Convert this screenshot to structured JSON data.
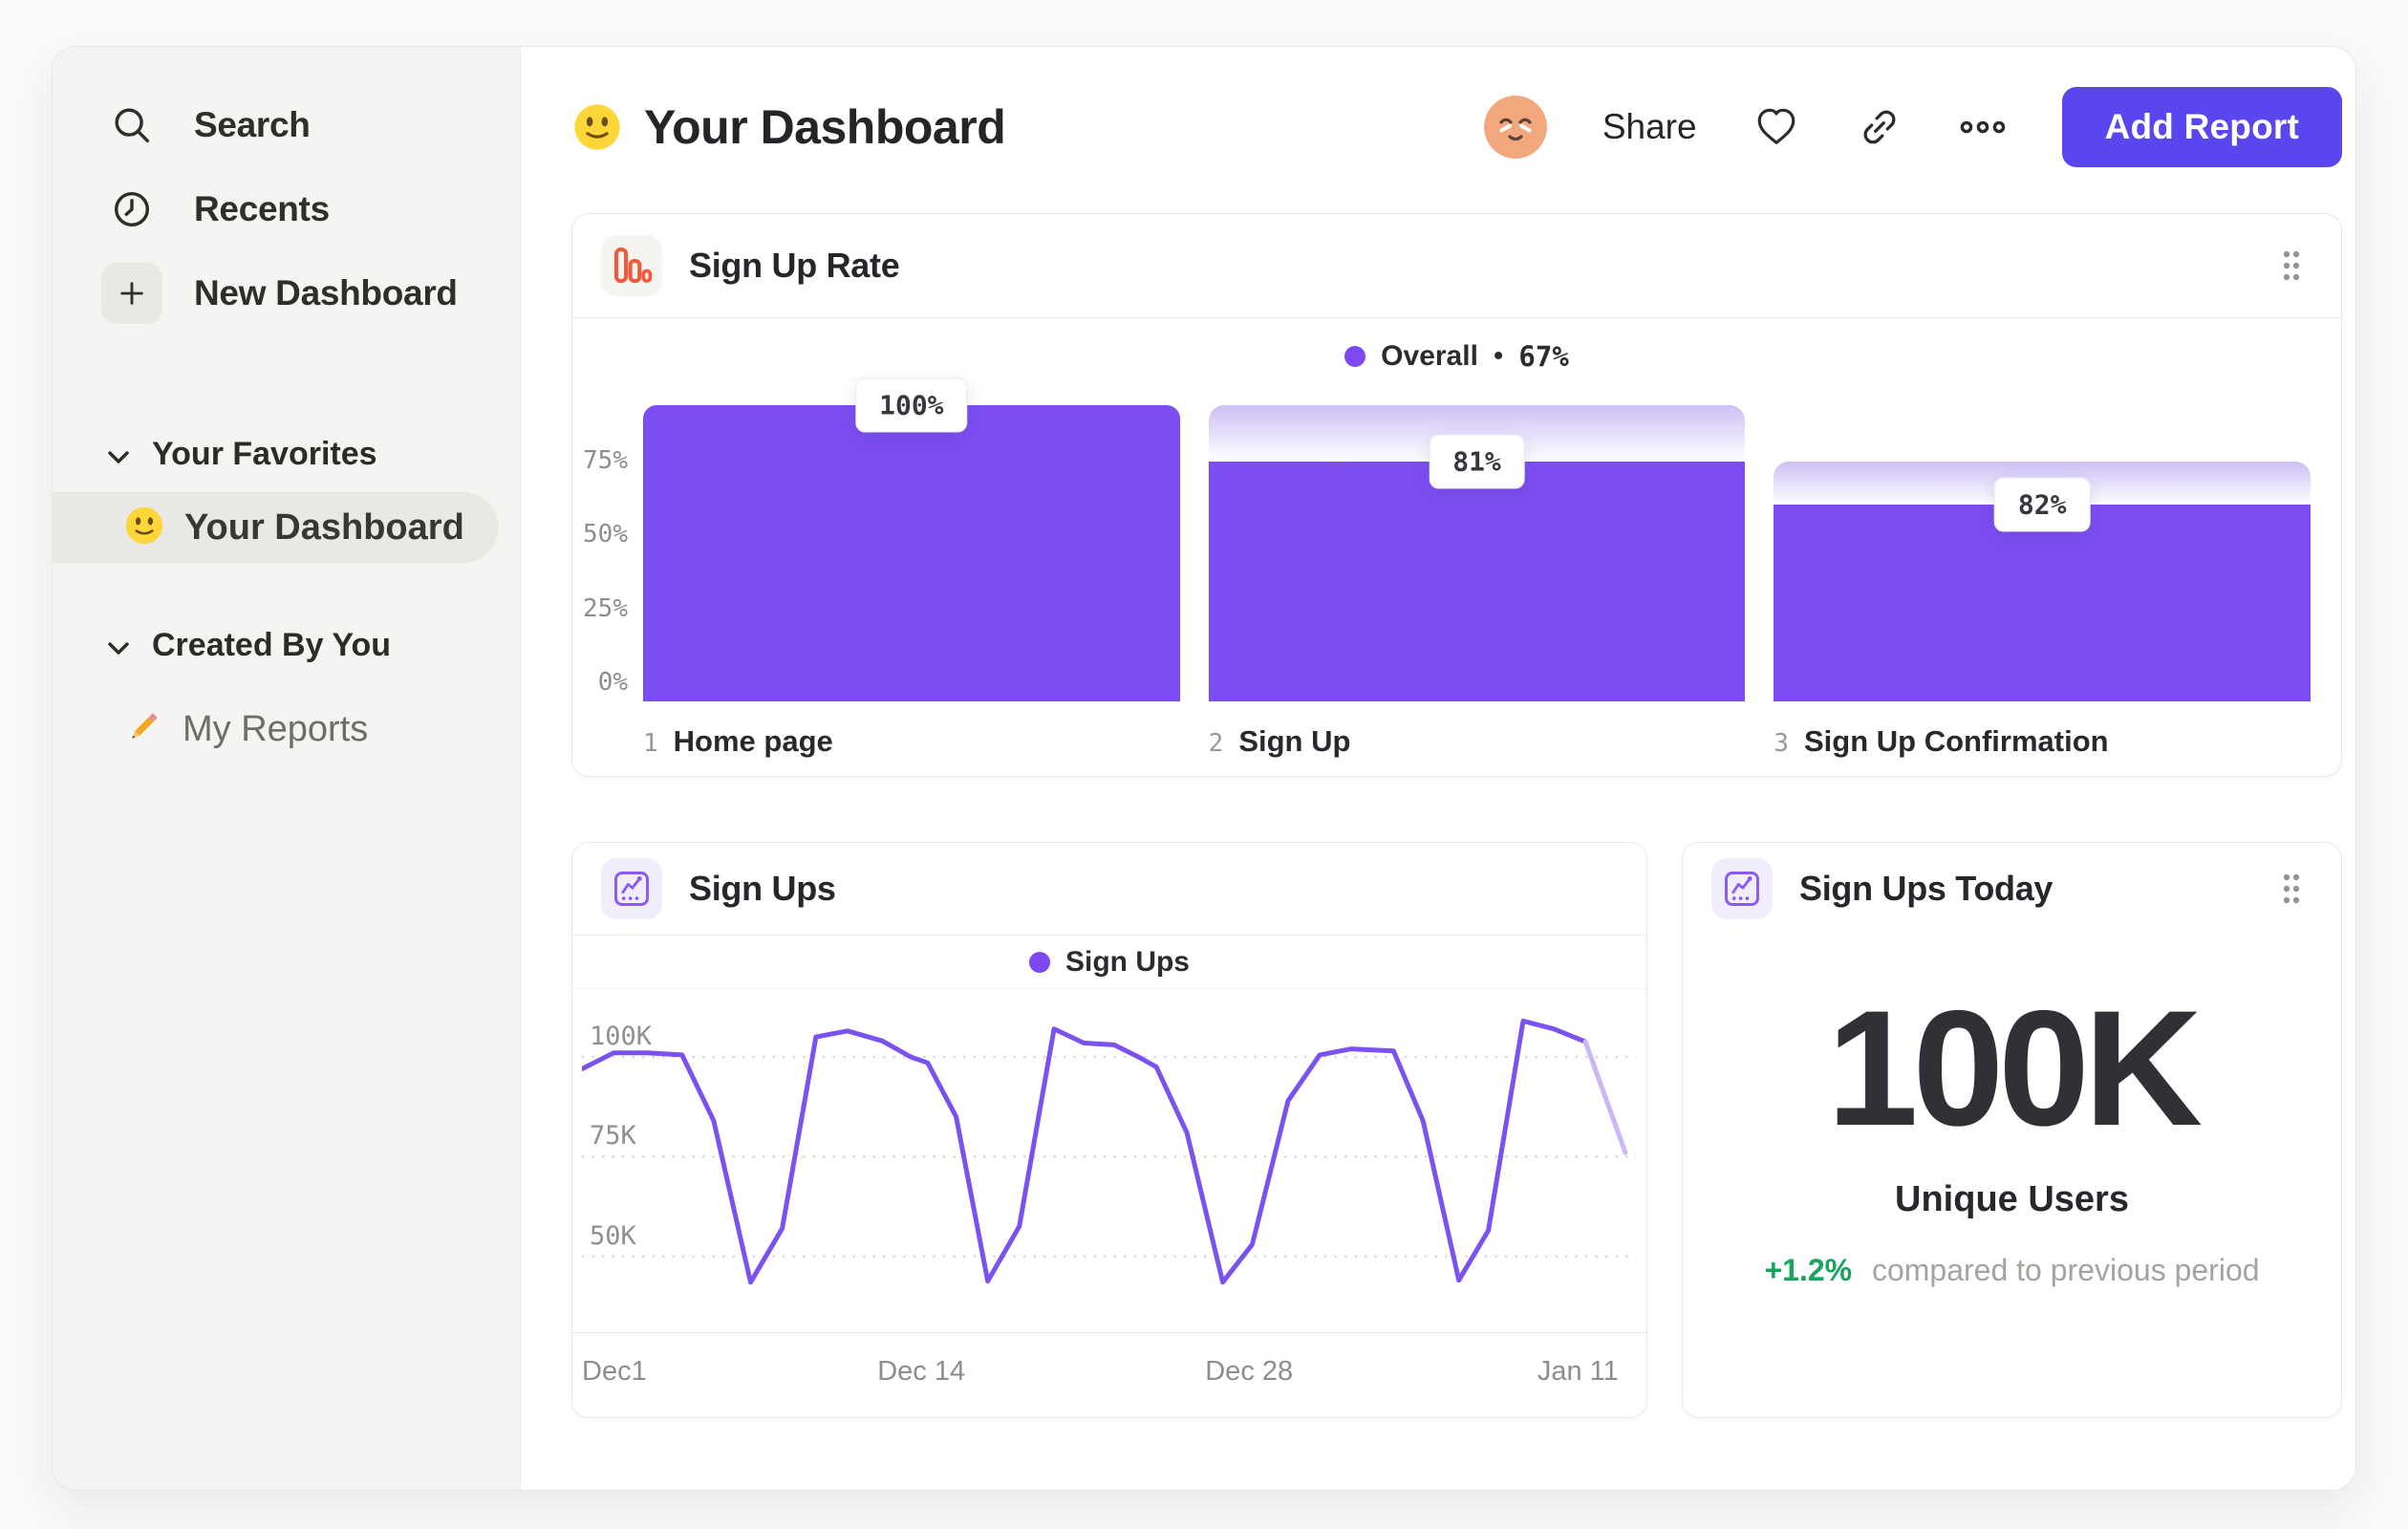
{
  "colors": {
    "accent_purple": "#7c4ef2",
    "button_purple": "#5a46ee",
    "line_purple": "#7b51f0",
    "funnel_fade_top": "#cdbff6",
    "icon_orange": "#f2593a",
    "icon_violet": "#8a5bf4",
    "positive_green": "#17a45c",
    "sidebar_bg": "#f5f4f2"
  },
  "sidebar": {
    "nav": [
      {
        "icon": "search-icon",
        "label": "Search"
      },
      {
        "icon": "clock-icon",
        "label": "Recents"
      },
      {
        "icon": "plus-icon",
        "label": "New Dashboard"
      }
    ],
    "sections": [
      {
        "label": "Your Favorites",
        "items": [
          {
            "emoji_char": "🙂",
            "emoji_name": "slightly-smiling-face",
            "label": "Your Dashboard",
            "selected": true
          }
        ]
      },
      {
        "label": "Created By You",
        "items": [
          {
            "emoji_char": "✏️",
            "emoji_name": "pencil",
            "label": "My Reports",
            "selected": false
          }
        ]
      }
    ]
  },
  "header": {
    "emoji_char": "🙂",
    "title": "Your Dashboard",
    "share_label": "Share",
    "icons": [
      "heart-icon",
      "link-icon",
      "ellipsis-icon"
    ],
    "add_report_label": "Add Report"
  },
  "cards": {
    "sign_up_rate": {
      "icon": "funnel-bars-icon",
      "title": "Sign Up Rate",
      "legend": {
        "label": "Overall",
        "separator": "•",
        "value": "67%"
      }
    },
    "sign_ups": {
      "icon": "trend-chart-icon",
      "title": "Sign Ups",
      "legend": {
        "label": "Sign Ups"
      }
    },
    "sign_ups_today": {
      "icon": "trend-chart-icon",
      "title": "Sign Ups Today",
      "value": "100K",
      "value_label": "Unique Users",
      "delta": "+1.2%",
      "delta_note": "compared to previous period"
    }
  },
  "chart_data": [
    {
      "type": "bar",
      "subtype": "funnel",
      "title": "Sign Up Rate",
      "legend": "Overall • 67%",
      "legend_position": "top-center",
      "categories": [
        "Home page",
        "Sign Up",
        "Sign Up Confirmation"
      ],
      "step_numbers": [
        "1",
        "2",
        "3"
      ],
      "step_conversion_pct": [
        100,
        81,
        82
      ],
      "overall_height_pct": [
        100,
        81,
        66.4
      ],
      "bar_labels": [
        "100%",
        "81%",
        "82%"
      ],
      "y_ticks": [
        {
          "label": "75%",
          "value": 75
        },
        {
          "label": "50%",
          "value": 50
        },
        {
          "label": "25%",
          "value": 25
        },
        {
          "label": "0%",
          "value": 0
        }
      ],
      "ylim": [
        0,
        100
      ],
      "grid": "off",
      "bar_color": "#7c4ef2",
      "fade_top_color": "#cdbff6"
    },
    {
      "type": "line",
      "title": "Sign Ups",
      "legend": "Sign Ups",
      "legend_position": "top-center",
      "line_color": "#7b51f0",
      "faded_tail_color": "#c9b7f7",
      "ylim": [
        31,
        117
      ],
      "y_ticks": [
        {
          "label": "100K",
          "value": 100
        },
        {
          "label": "75K",
          "value": 75
        },
        {
          "label": "50K",
          "value": 50
        }
      ],
      "grid": "dashed-horizontal",
      "x_ticks": [
        {
          "label": "Dec1",
          "frac": 0.0
        },
        {
          "label": "Dec 14",
          "frac": 0.322
        },
        {
          "label": "Dec 28",
          "frac": 0.633
        },
        {
          "label": "Jan 11",
          "frac": 0.945
        }
      ],
      "x_unit": "day",
      "y_unit": "sign-ups (thousands)",
      "points": [
        [
          0.0,
          97
        ],
        [
          0.03,
          101
        ],
        [
          0.062,
          101
        ],
        [
          0.095,
          100.5
        ],
        [
          0.125,
          84
        ],
        [
          0.16,
          43.5
        ],
        [
          0.19,
          57
        ],
        [
          0.222,
          105
        ],
        [
          0.252,
          106.5
        ],
        [
          0.285,
          104
        ],
        [
          0.312,
          100
        ],
        [
          0.328,
          98.5
        ],
        [
          0.355,
          85
        ],
        [
          0.385,
          43.8
        ],
        [
          0.415,
          57.5
        ],
        [
          0.448,
          107
        ],
        [
          0.476,
          103.5
        ],
        [
          0.505,
          103
        ],
        [
          0.528,
          100
        ],
        [
          0.545,
          97.5
        ],
        [
          0.574,
          81
        ],
        [
          0.608,
          43.5
        ],
        [
          0.636,
          53
        ],
        [
          0.67,
          89
        ],
        [
          0.7,
          100.5
        ],
        [
          0.73,
          102
        ],
        [
          0.746,
          101.8
        ],
        [
          0.77,
          101.5
        ],
        [
          0.798,
          84
        ],
        [
          0.832,
          44
        ],
        [
          0.86,
          56.5
        ],
        [
          0.893,
          109
        ],
        [
          0.922,
          107
        ],
        [
          0.952,
          103.8
        ],
        [
          0.99,
          76
        ]
      ],
      "faded_tail_from_index": 33
    }
  ]
}
